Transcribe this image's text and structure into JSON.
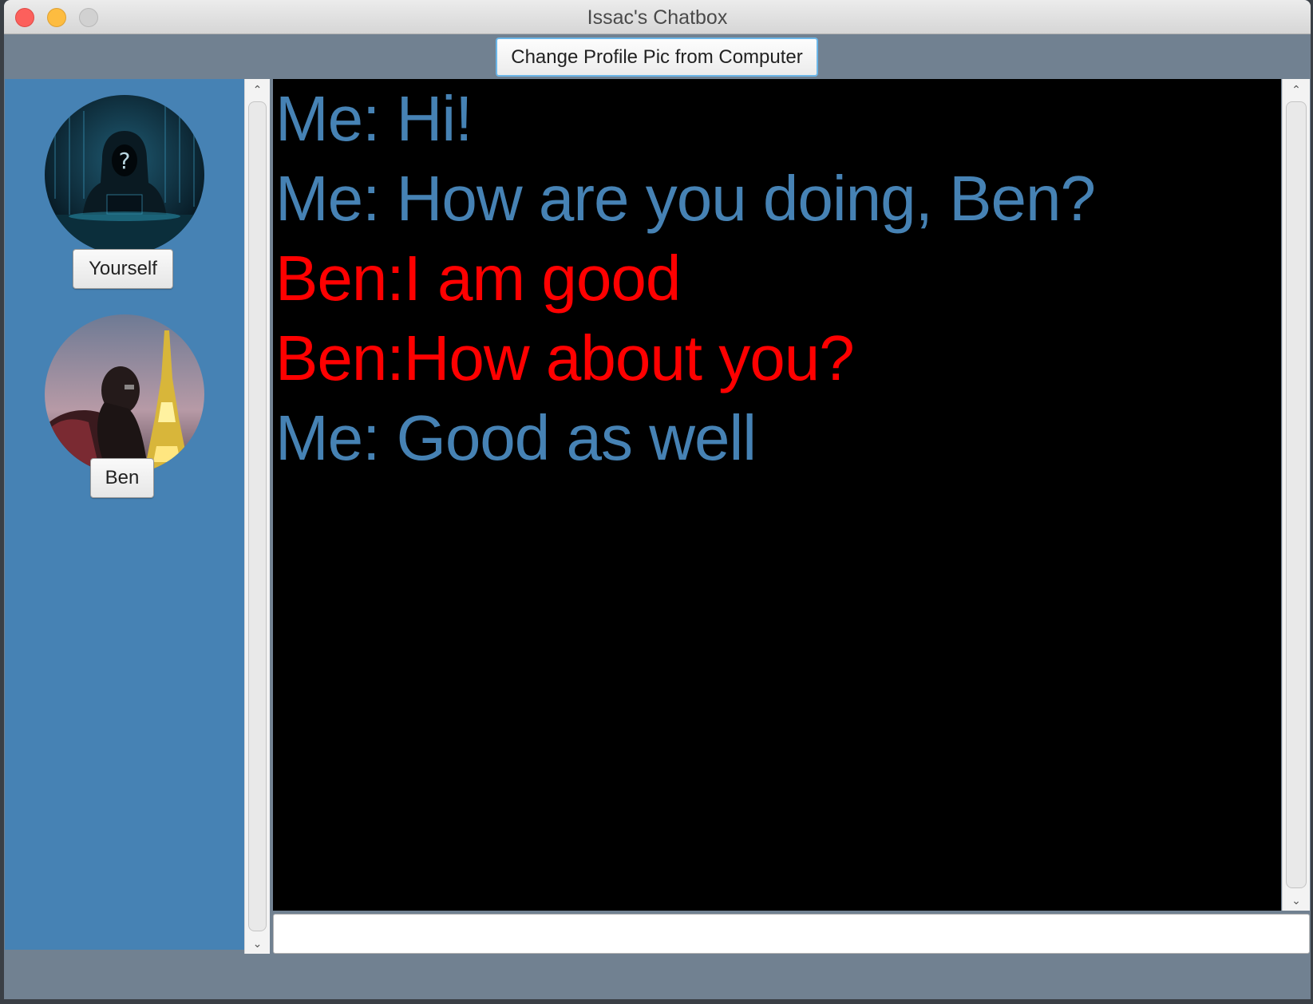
{
  "window": {
    "title": "Issac's Chatbox"
  },
  "toolbar": {
    "change_pic_label": "Change Profile Pic from Computer"
  },
  "contacts": [
    {
      "label": "Yourself"
    },
    {
      "label": "Ben"
    }
  ],
  "colors": {
    "sidebar_bg": "#4682b4",
    "me_text": "#4682b4",
    "other_text": "#ff0000",
    "chat_bg": "#000000"
  },
  "messages": [
    {
      "sender": "me",
      "text": "Me: Hi!"
    },
    {
      "sender": "me",
      "text": "Me: How are you doing, Ben?"
    },
    {
      "sender": "other",
      "text": "Ben:I am good"
    },
    {
      "sender": "other",
      "text": "Ben:How about you?"
    },
    {
      "sender": "me",
      "text": "Me: Good as well"
    }
  ],
  "input": {
    "value": "",
    "placeholder": ""
  }
}
